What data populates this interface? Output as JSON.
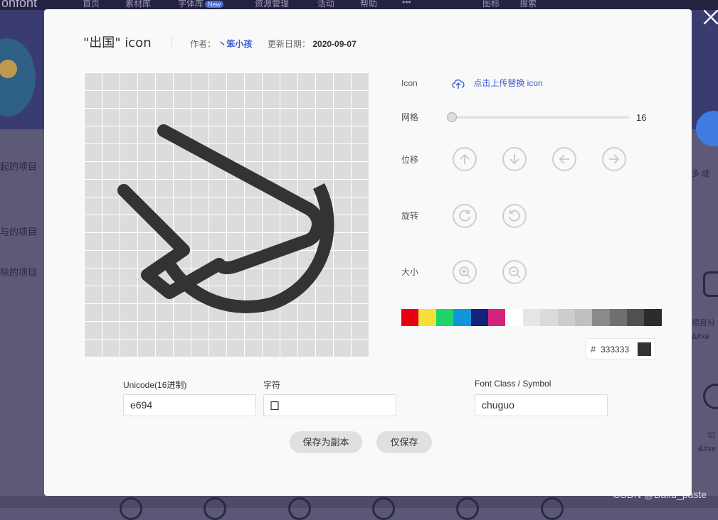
{
  "background": {
    "logo": "onfont",
    "nav_items": [
      "首页",
      "素材库",
      "字体库",
      "资源管理",
      "活动",
      "帮助",
      "•••",
      "图标",
      "搜索"
    ],
    "sidebar_items": [
      "起的项目",
      "与的项目",
      "除的项目"
    ],
    "right_texts": [
      "多 成",
      "项目分",
      "&#xe",
      "切",
      "&#xe"
    ],
    "watermark": "CSDN @Baifu_paste"
  },
  "modal": {
    "title": "\"出国\" icon",
    "author_label": "作者：",
    "author": "丶笨小孩",
    "date_label": "更新日期：",
    "date": "2020-09-07",
    "close_icon": "close-icon",
    "glyph_icon": "airplane-departure-icon"
  },
  "controls": {
    "icon_label": "Icon",
    "upload_label": "点击上传替换 icon",
    "grid_label": "网格",
    "grid_value": "16",
    "grid_fraction": 0.0,
    "move_label": "位移",
    "rotate_label": "旋转",
    "size_label": "大小",
    "move_icons": [
      "arrow-up-icon",
      "arrow-down-icon",
      "arrow-left-icon",
      "arrow-right-icon"
    ],
    "rotate_icons": [
      "rotate-clockwise-icon",
      "rotate-counterclockwise-icon"
    ],
    "size_icons": [
      "zoom-in-icon",
      "zoom-out-icon"
    ]
  },
  "palette": {
    "colors": [
      "#e60012",
      "#f5e03a",
      "#1dd56a",
      "#1296db",
      "#13227a",
      "#d4237a",
      "#ffffff",
      "#e6e6e6",
      "#dbdbdb",
      "#cdcdcd",
      "#bfbfbf",
      "#8a8a8a",
      "#707070",
      "#515151",
      "#2c2c2c"
    ],
    "hash_symbol": "#",
    "current_hex": "333333",
    "current_color": "#333333"
  },
  "form": {
    "unicode_label": "Unicode(16进制)",
    "unicode_value": "e694",
    "char_label": "字符",
    "char_value": "",
    "font_class_label": "Font Class / Symbol",
    "font_class_value": "chuguo"
  },
  "buttons": {
    "save_copy": "保存为副本",
    "save_only": "仅保存"
  }
}
